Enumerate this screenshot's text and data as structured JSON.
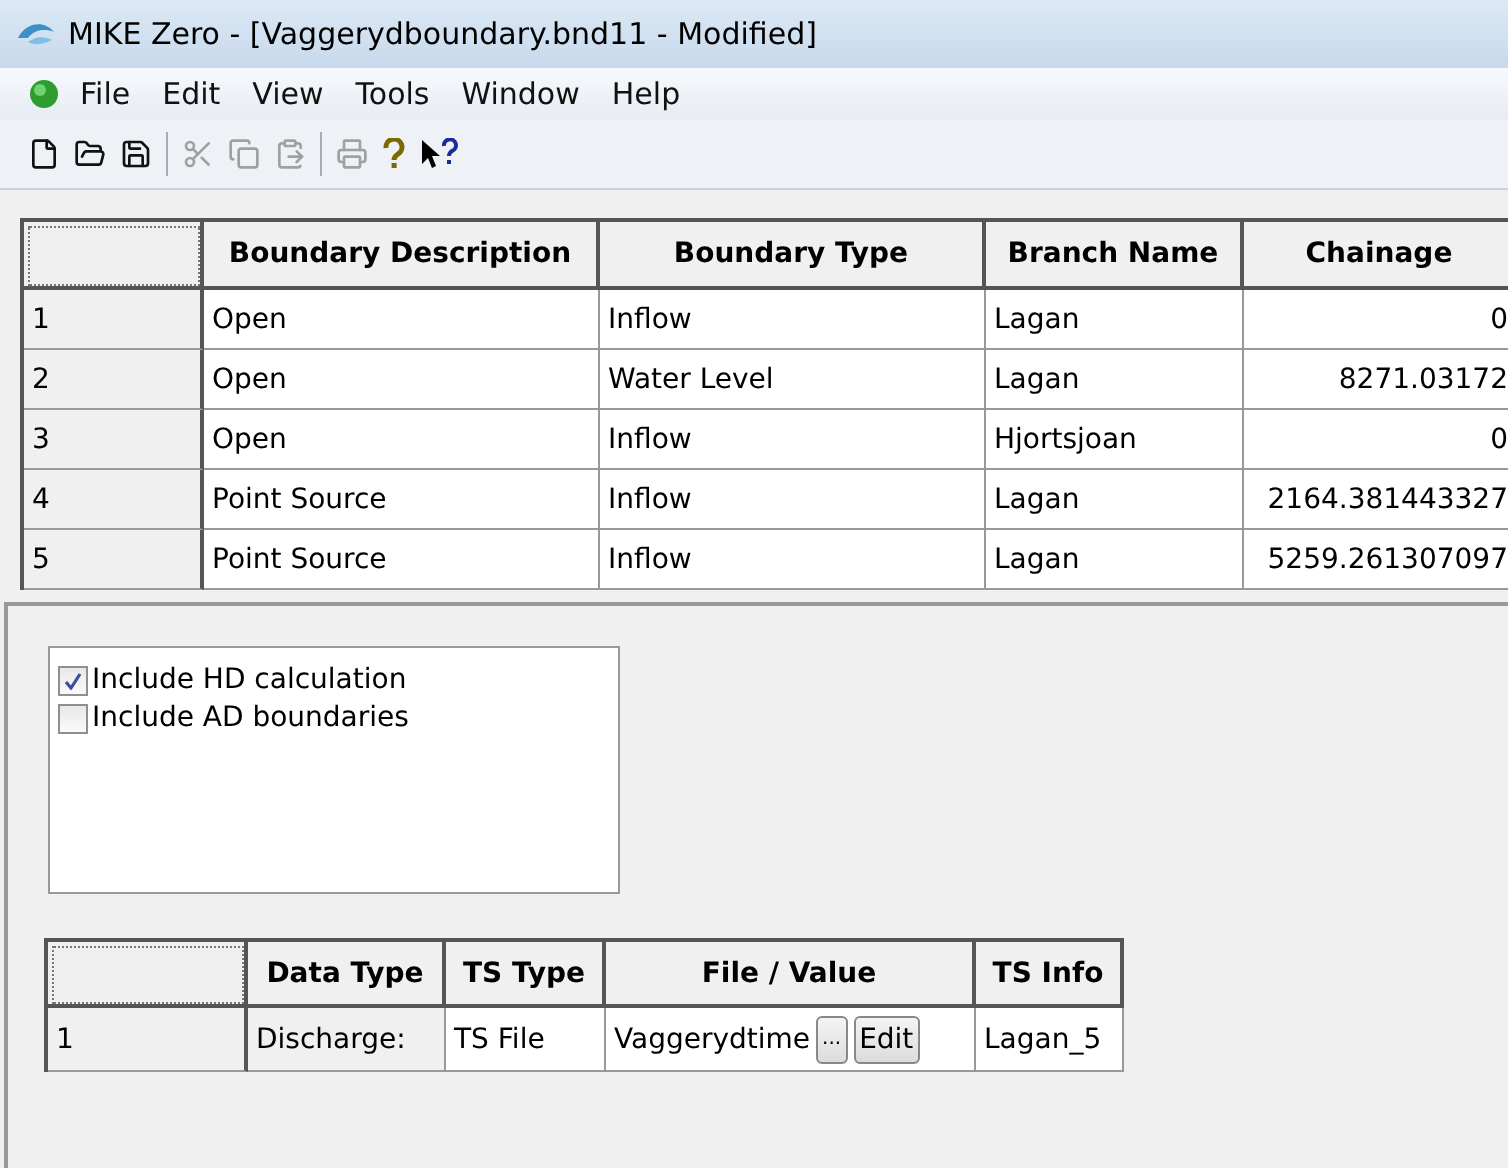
{
  "window": {
    "title": "MIKE Zero - [Vaggerydboundary.bnd11 - Modified]"
  },
  "menu": [
    "File",
    "Edit",
    "View",
    "Tools",
    "Window",
    "Help"
  ],
  "toolbar": [
    {
      "kind": "new",
      "disabled": false
    },
    {
      "kind": "open",
      "disabled": false
    },
    {
      "kind": "save",
      "disabled": false
    },
    {
      "kind": "separator"
    },
    {
      "kind": "cut",
      "disabled": true
    },
    {
      "kind": "copy",
      "disabled": true
    },
    {
      "kind": "paste",
      "disabled": true
    },
    {
      "kind": "separator"
    },
    {
      "kind": "print",
      "disabled": true
    },
    {
      "kind": "help",
      "disabled": false
    },
    {
      "kind": "contexthelp",
      "disabled": false
    }
  ],
  "table": {
    "columns": [
      "Boundary Description",
      "Boundary Type",
      "Branch Name",
      "Chainage"
    ],
    "rows": [
      {
        "number": "1",
        "cells": [
          "Open",
          "Inflow",
          "Lagan",
          "0"
        ]
      },
      {
        "number": "2",
        "cells": [
          "Open",
          "Water Level",
          "Lagan",
          "8271.03172"
        ]
      },
      {
        "number": "3",
        "cells": [
          "Open",
          "Inflow",
          "Hjortsjoan",
          "0"
        ]
      },
      {
        "number": "4",
        "cells": [
          "Point Source",
          "Inflow",
          "Lagan",
          "2164.381443327"
        ]
      },
      {
        "number": "5",
        "cells": [
          "Point Source",
          "Inflow",
          "Lagan",
          "5259.261307097"
        ]
      }
    ]
  },
  "options": [
    {
      "label": "Include HD calculation",
      "checked": true
    },
    {
      "label": "Include AD boundaries",
      "checked": false
    }
  ],
  "ts_table": {
    "columns": [
      "Data Type",
      "TS Type",
      "File / Value",
      "TS Info"
    ],
    "rows": [
      {
        "number": "1",
        "data_type": "Discharge:",
        "ts_type": "TS File",
        "file_value": "Vaggerydtime",
        "browse_button": "...",
        "edit_button": "Edit",
        "ts_info": "Lagan_5"
      }
    ]
  }
}
